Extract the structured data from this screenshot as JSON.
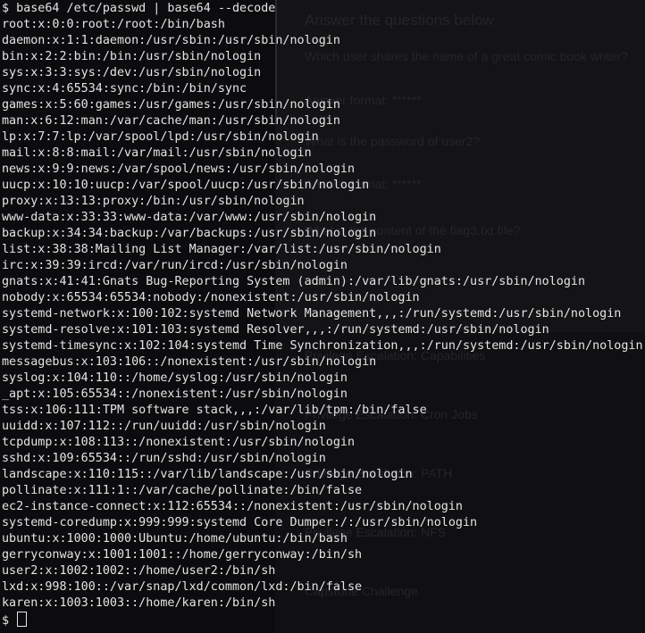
{
  "background_page": {
    "heading": "Answer the questions below",
    "q1": "Which user shares the name of a great comic book writer?",
    "a1_placeholder": "Answer format: ******",
    "q2": "What is the password of user2?",
    "a2_placeholder": "Answer format: ******",
    "q3": "What is the content of the flag3.txt file?",
    "sections": [
      "Privilege Escalation: Capabilities",
      "Privilege Escalation: Cron Jobs",
      "Privilege Escalation: PATH",
      "Privilege Escalation: NFS",
      "Capstone Challenge"
    ]
  },
  "terminal": {
    "command": "$ base64 /etc/passwd | base64 --decode",
    "output": [
      "root:x:0:0:root:/root:/bin/bash",
      "daemon:x:1:1:daemon:/usr/sbin:/usr/sbin/nologin",
      "bin:x:2:2:bin:/bin:/usr/sbin/nologin",
      "sys:x:3:3:sys:/dev:/usr/sbin/nologin",
      "sync:x:4:65534:sync:/bin:/bin/sync",
      "games:x:5:60:games:/usr/games:/usr/sbin/nologin",
      "man:x:6:12:man:/var/cache/man:/usr/sbin/nologin",
      "lp:x:7:7:lp:/var/spool/lpd:/usr/sbin/nologin",
      "mail:x:8:8:mail:/var/mail:/usr/sbin/nologin",
      "news:x:9:9:news:/var/spool/news:/usr/sbin/nologin",
      "uucp:x:10:10:uucp:/var/spool/uucp:/usr/sbin/nologin",
      "proxy:x:13:13:proxy:/bin:/usr/sbin/nologin",
      "www-data:x:33:33:www-data:/var/www:/usr/sbin/nologin",
      "backup:x:34:34:backup:/var/backups:/usr/sbin/nologin",
      "list:x:38:38:Mailing List Manager:/var/list:/usr/sbin/nologin",
      "irc:x:39:39:ircd:/var/run/ircd:/usr/sbin/nologin",
      "gnats:x:41:41:Gnats Bug-Reporting System (admin):/var/lib/gnats:/usr/sbin/nologin",
      "nobody:x:65534:65534:nobody:/nonexistent:/usr/sbin/nologin",
      "systemd-network:x:100:102:systemd Network Management,,,:/run/systemd:/usr/sbin/nologin",
      "systemd-resolve:x:101:103:systemd Resolver,,,:/run/systemd:/usr/sbin/nologin",
      "systemd-timesync:x:102:104:systemd Time Synchronization,,,:/run/systemd:/usr/sbin/nologin",
      "messagebus:x:103:106::/nonexistent:/usr/sbin/nologin",
      "syslog:x:104:110::/home/syslog:/usr/sbin/nologin",
      "_apt:x:105:65534::/nonexistent:/usr/sbin/nologin",
      "tss:x:106:111:TPM software stack,,,:/var/lib/tpm:/bin/false",
      "uuidd:x:107:112::/run/uuidd:/usr/sbin/nologin",
      "tcpdump:x:108:113::/nonexistent:/usr/sbin/nologin",
      "sshd:x:109:65534::/run/sshd:/usr/sbin/nologin",
      "landscape:x:110:115::/var/lib/landscape:/usr/sbin/nologin",
      "pollinate:x:111:1::/var/cache/pollinate:/bin/false",
      "ec2-instance-connect:x:112:65534::/nonexistent:/usr/sbin/nologin",
      "systemd-coredump:x:999:999:systemd Core Dumper:/:/usr/sbin/nologin",
      "ubuntu:x:1000:1000:Ubuntu:/home/ubuntu:/bin/bash",
      "gerryconway:x:1001:1001::/home/gerryconway:/bin/sh",
      "user2:x:1002:1002::/home/user2:/bin/sh",
      "lxd:x:998:100::/var/snap/lxd/common/lxd:/bin/false",
      "karen:x:1003:1003::/home/karen:/bin/sh"
    ],
    "prompt": "$ "
  },
  "colors": {
    "terminal_bg": "#0c0c0e",
    "terminal_fg": "#e4e4e4"
  }
}
